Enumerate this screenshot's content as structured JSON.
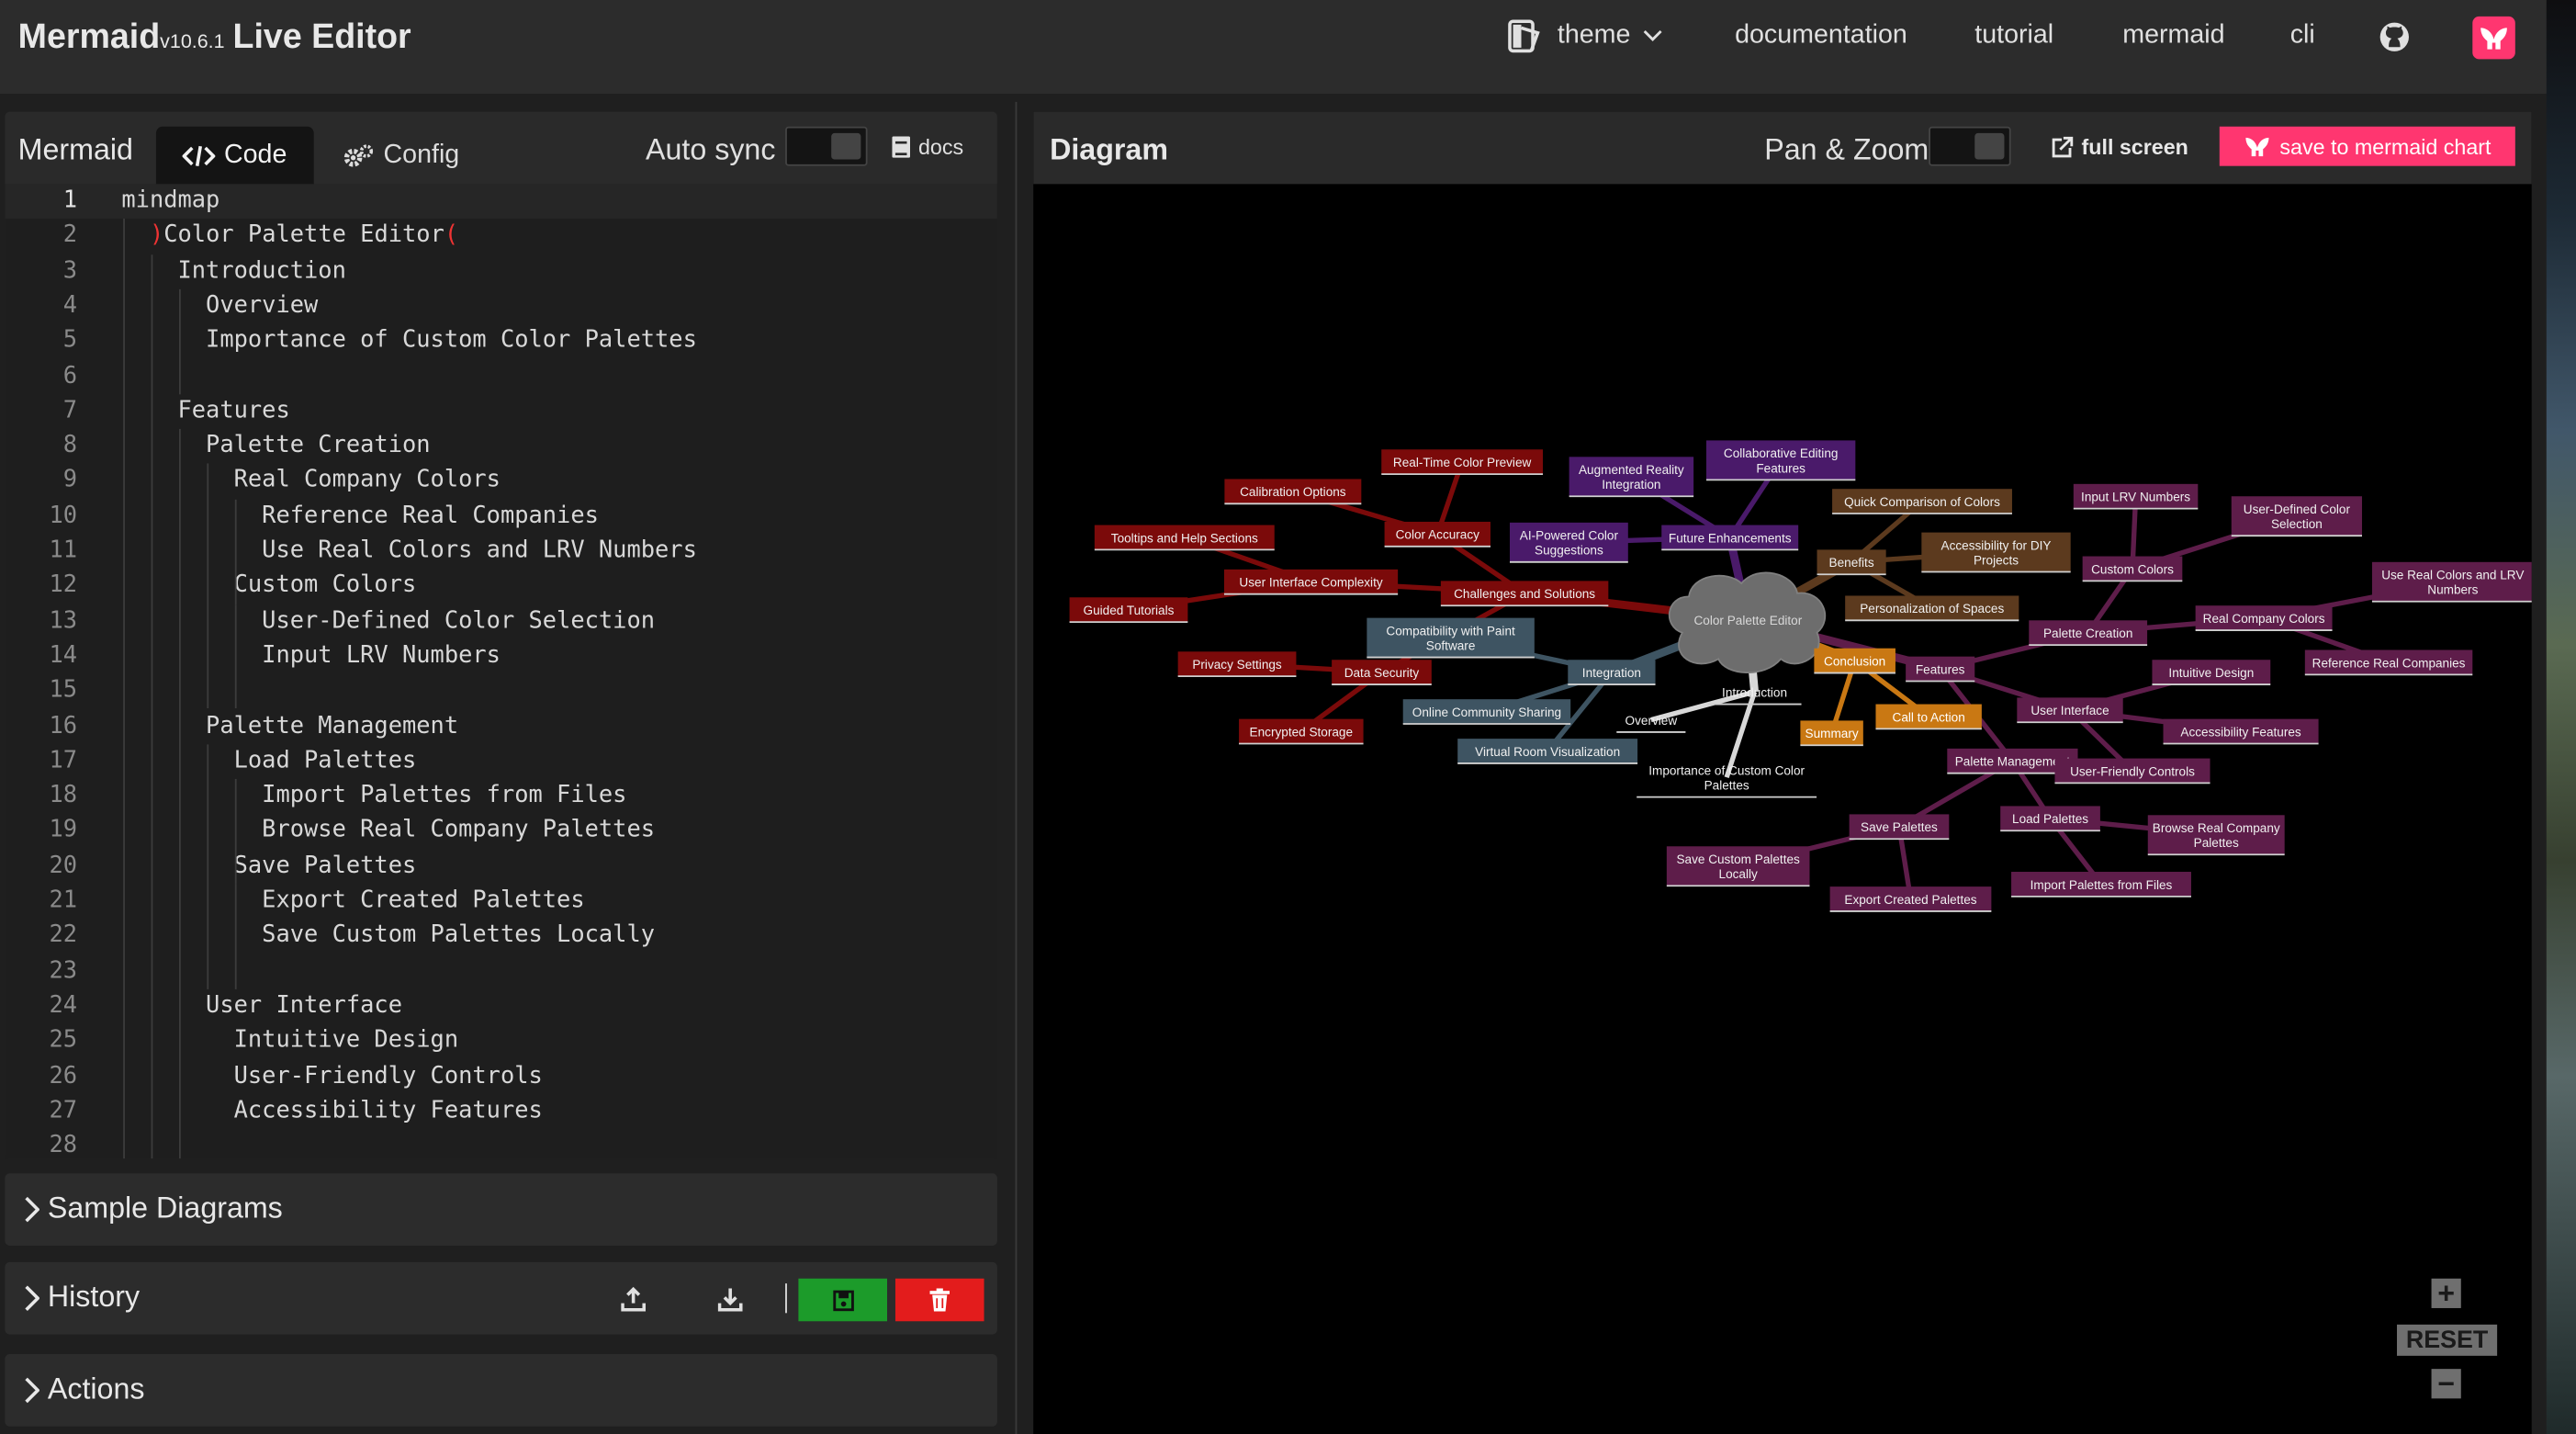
{
  "header": {
    "app_name": "Mermaid",
    "version": "v10.6.1",
    "title_suffix": "Live Editor",
    "theme_label": "theme",
    "nav": [
      "documentation",
      "tutorial",
      "mermaid",
      "cli"
    ]
  },
  "editor": {
    "title": "Mermaid",
    "tab_code": "Code",
    "tab_config": "Config",
    "auto_sync_label": "Auto sync",
    "docs_label": "docs",
    "lines": [
      "mindmap",
      "  )Color Palette Editor(",
      "    Introduction",
      "      Overview",
      "      Importance of Custom Color Palettes",
      "",
      "    Features",
      "      Palette Creation",
      "        Real Company Colors",
      "          Reference Real Companies",
      "          Use Real Colors and LRV Numbers",
      "        Custom Colors",
      "          User-Defined Color Selection",
      "          Input LRV Numbers",
      "",
      "      Palette Management",
      "        Load Palettes",
      "          Import Palettes from Files",
      "          Browse Real Company Palettes",
      "        Save Palettes",
      "          Export Created Palettes",
      "          Save Custom Palettes Locally",
      "",
      "      User Interface",
      "        Intuitive Design",
      "        User-Friendly Controls",
      "        Accessibility Features",
      ""
    ]
  },
  "sections": {
    "samples": "Sample Diagrams",
    "history": "History",
    "actions": "Actions"
  },
  "diagram": {
    "title": "Diagram",
    "pan_zoom_label": "Pan & Zoom",
    "full_screen_label": "full screen",
    "save_label": "save to mermaid chart",
    "reset_label": "RESET",
    "zoom_in": "+",
    "zoom_out": "−"
  },
  "mindmap": {
    "root": "Color Palette Editor",
    "colors": {
      "red": "#7b0a0a",
      "orange": "#c97813",
      "purple": "#4a1a6a",
      "magenta": "#5e1d4a",
      "brown": "#5c3a1e",
      "slate": "#3e5462"
    },
    "nodes": [
      {
        "id": "rt",
        "label": "Real-Time Color Preview",
        "c": "red"
      },
      {
        "id": "cal",
        "label": "Calibration Options",
        "c": "red"
      },
      {
        "id": "ca",
        "label": "Color Accuracy",
        "c": "red"
      },
      {
        "id": "tt",
        "label": "Tooltips and Help Sections",
        "c": "red"
      },
      {
        "id": "uic",
        "label": "User Interface Complexity",
        "c": "red"
      },
      {
        "id": "cs",
        "label": "Challenges and Solutions",
        "c": "red"
      },
      {
        "id": "gt",
        "label": "Guided Tutorials",
        "c": "red"
      },
      {
        "id": "ps",
        "label": "Privacy Settings",
        "c": "red"
      },
      {
        "id": "ds",
        "label": "Data Security",
        "c": "red"
      },
      {
        "id": "es",
        "label": "Encrypted Storage",
        "c": "red"
      },
      {
        "id": "cwp",
        "label": "Compatibility with Paint Software",
        "c": "slate"
      },
      {
        "id": "int",
        "label": "Integration",
        "c": "slate"
      },
      {
        "id": "ocs",
        "label": "Online Community Sharing",
        "c": "slate"
      },
      {
        "id": "vrv",
        "label": "Virtual Room Visualization",
        "c": "slate"
      },
      {
        "id": "ar",
        "label": "Augmented Reality Integration",
        "c": "purple"
      },
      {
        "id": "cef",
        "label": "Collaborative Editing Features",
        "c": "purple"
      },
      {
        "id": "ai",
        "label": "AI-Powered Color Suggestions",
        "c": "purple"
      },
      {
        "id": "fe",
        "label": "Future Enhancements",
        "c": "purple"
      },
      {
        "id": "qc",
        "label": "Quick Comparison of Colors",
        "c": "brown"
      },
      {
        "id": "ben",
        "label": "Benefits",
        "c": "brown"
      },
      {
        "id": "adiy",
        "label": "Accessibility for DIY Projects",
        "c": "brown"
      },
      {
        "id": "pos",
        "label": "Personalization of Spaces",
        "c": "brown"
      },
      {
        "id": "ilrv",
        "label": "Input LRV Numbers",
        "c": "magenta"
      },
      {
        "id": "udc",
        "label": "User-Defined Color Selection",
        "c": "magenta"
      },
      {
        "id": "cc",
        "label": "Custom Colors",
        "c": "magenta"
      },
      {
        "id": "urc",
        "label": "Use Real Colors and LRV Numbers",
        "c": "magenta"
      },
      {
        "id": "pc",
        "label": "Palette Creation",
        "c": "magenta"
      },
      {
        "id": "rcc",
        "label": "Real Company Colors",
        "c": "magenta"
      },
      {
        "id": "feat",
        "label": "Features",
        "c": "magenta"
      },
      {
        "id": "id",
        "label": "Intuitive Design",
        "c": "magenta"
      },
      {
        "id": "rrc",
        "label": "Reference Real Companies",
        "c": "magenta"
      },
      {
        "id": "ui",
        "label": "User Interface",
        "c": "magenta"
      },
      {
        "id": "af",
        "label": "Accessibility Features",
        "c": "magenta"
      },
      {
        "id": "pm",
        "label": "Palette Management",
        "c": "magenta"
      },
      {
        "id": "ufc",
        "label": "User-Friendly Controls",
        "c": "magenta"
      },
      {
        "id": "sp",
        "label": "Save Palettes",
        "c": "magenta"
      },
      {
        "id": "lp",
        "label": "Load Palettes",
        "c": "magenta"
      },
      {
        "id": "brc",
        "label": "Browse Real Company Palettes",
        "c": "magenta"
      },
      {
        "id": "scp",
        "label": "Save Custom Palettes Locally",
        "c": "magenta"
      },
      {
        "id": "ecp",
        "label": "Export Created Palettes",
        "c": "magenta"
      },
      {
        "id": "ipf",
        "label": "Import Palettes from Files",
        "c": "magenta"
      },
      {
        "id": "con",
        "label": "Conclusion",
        "c": "orange"
      },
      {
        "id": "cta",
        "label": "Call to Action",
        "c": "orange"
      },
      {
        "id": "sum",
        "label": "Summary",
        "c": "orange"
      },
      {
        "id": "intro",
        "label": "Introduction",
        "c": "plain"
      },
      {
        "id": "ov",
        "label": "Overview",
        "c": "plain"
      },
      {
        "id": "icp",
        "label": "Importance of Custom Color Palettes",
        "c": "plain"
      }
    ]
  }
}
